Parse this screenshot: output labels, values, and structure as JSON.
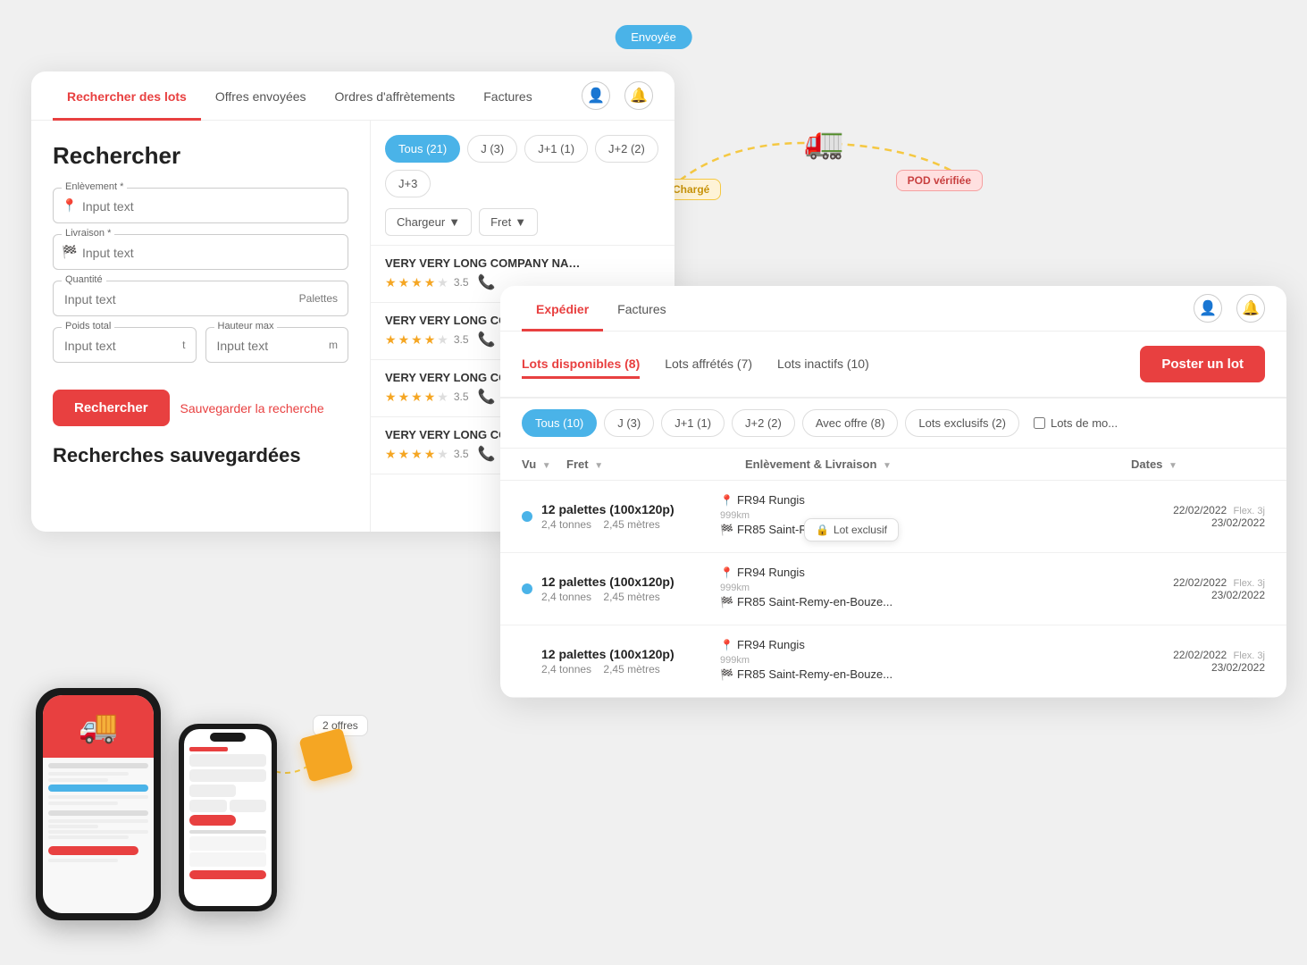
{
  "envoyee": "Envoyée",
  "nav": {
    "tabs": [
      "Rechercher des lots",
      "Offres envoyées",
      "Ordres d'affrètements",
      "Factures"
    ]
  },
  "form": {
    "title": "Rechercher",
    "enlevement_label": "Enlèvement *",
    "enlevement_placeholder": "Input text",
    "livraison_label": "Livraison *",
    "livraison_placeholder": "Input text",
    "quantite_label": "Quantité",
    "quantite_placeholder": "Input text",
    "quantite_suffix": "Palettes",
    "poids_label": "Poids total",
    "poids_placeholder": "Input text",
    "poids_suffix": "t",
    "hauteur_label": "Hauteur max",
    "hauteur_placeholder": "Input text",
    "hauteur_suffix": "m",
    "btn_search": "Rechercher",
    "btn_save": "Sauvegarder la recherche",
    "saved_title": "Recherches sauvegardées"
  },
  "results": {
    "filter_tabs": [
      {
        "label": "Tous (21)",
        "active": true
      },
      {
        "label": "J (3)",
        "active": false
      },
      {
        "label": "J+1 (1)",
        "active": false
      },
      {
        "label": "J+2 (2)",
        "active": false
      },
      {
        "label": "J+3",
        "active": false
      }
    ],
    "col_chargeur": "Chargeur",
    "col_fret": "Fret",
    "companies": [
      {
        "name": "VERY VERY LONG COMPANY NAM...",
        "rating": 3.5
      },
      {
        "name": "VERY VERY LONG COMPANY",
        "rating": 3.5
      },
      {
        "name": "VERY VERY LONG COMPANY",
        "rating": 3.5
      },
      {
        "name": "VERY VERY LONG COMPANY",
        "rating": 3.5
      }
    ]
  },
  "overlay": {
    "tabs": [
      "Expédier",
      "Factures"
    ],
    "active_tab": "Expédier",
    "lot_tabs": [
      {
        "label": "Lots disponibles (8)",
        "active": true
      },
      {
        "label": "Lots affrétés (7)",
        "active": false
      },
      {
        "label": "Lots inactifs (10)",
        "active": false
      }
    ],
    "btn_poster": "Poster un lot",
    "sub_filters": [
      {
        "label": "Tous (10)",
        "active": true
      },
      {
        "label": "J (3)",
        "active": false
      },
      {
        "label": "J+1 (1)",
        "active": false
      },
      {
        "label": "J+2 (2)",
        "active": false
      },
      {
        "label": "Avec offre (8)",
        "active": false
      },
      {
        "label": "Lots exclusifs (2)",
        "active": false
      }
    ],
    "checkbox_label": "Lots de mo...",
    "table_headers": [
      "Vu",
      "Fret",
      "Enlèvement & Livraison",
      "Dates"
    ],
    "rows": [
      {
        "fret_main": "12 palettes (100x120p)",
        "fret_sub1": "2,4 tonnes",
        "fret_sub2": "2,45 mètres",
        "el_from": "FR94 Rungis",
        "el_to": "FR85 Saint-Remy-en-Bouze...",
        "distance": "999km",
        "date1": "22/02/2022",
        "date2": "23/02/2022",
        "flex": "Flex. 3j"
      },
      {
        "fret_main": "12 palettes (100x120p)",
        "fret_sub1": "2,4 tonnes",
        "fret_sub2": "2,45 mètres",
        "el_from": "FR94 Rungis",
        "el_to": "FR85 Saint-Remy-en-Bouze...",
        "distance": "999km",
        "date1": "22/02/2022",
        "date2": "23/02/2022",
        "flex": "Flex. 3j"
      },
      {
        "fret_main": "12 palettes (100x120p)",
        "fret_sub1": "2,4 tonnes",
        "fret_sub2": "2,45 mètres",
        "el_from": "FR94 Rungis",
        "el_to": "FR85 Saint-Remy-en-Bouze...",
        "distance": "999km",
        "date1": "22/02/2022",
        "date2": "23/02/2022",
        "flex": "Flex. 3j"
      }
    ]
  },
  "truck": {
    "charge_label": "Chargé",
    "pod_label": "POD vérifiée"
  },
  "floating": {
    "offers_label": "2 offres",
    "lot_exclusif_label": "Lot exclusif"
  }
}
